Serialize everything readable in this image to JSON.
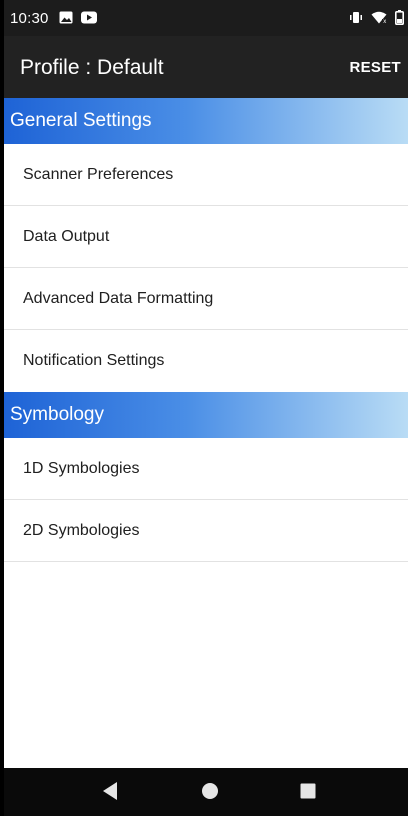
{
  "status_bar": {
    "time": "10:30",
    "icons": [
      "image-notification-icon",
      "youtube-notification-icon",
      "vibrate-icon",
      "wifi-icon",
      "battery-icon"
    ]
  },
  "app_bar": {
    "title": "Profile : Default",
    "reset_label": "RESET"
  },
  "sections": [
    {
      "header": "General Settings",
      "items": [
        "Scanner Preferences",
        "Data Output",
        "Advanced Data Formatting",
        "Notification Settings"
      ]
    },
    {
      "header": "Symbology",
      "items": [
        "1D Symbologies",
        "2D Symbologies"
      ]
    }
  ],
  "nav_bar": {
    "icons": [
      "back-icon",
      "home-icon",
      "recents-icon"
    ]
  },
  "colors": {
    "header_gradient_start": "#1e63d6",
    "header_gradient_end": "#b9dcf5",
    "app_bar": "#222222",
    "status_bar": "#1c1c1c"
  }
}
